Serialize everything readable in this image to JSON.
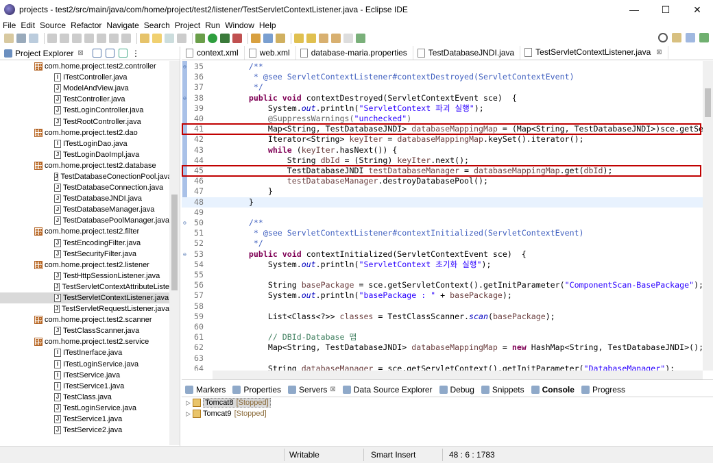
{
  "window": {
    "title": "projects - test2/src/main/java/com/home/project/test2/listener/TestServletContextListener.java - Eclipse IDE",
    "minimize": "—",
    "maximize": "☐",
    "close": "✕"
  },
  "menu": [
    "File",
    "Edit",
    "Source",
    "Refactor",
    "Navigate",
    "Search",
    "Project",
    "Run",
    "Window",
    "Help"
  ],
  "explorer": {
    "title": "Project Explorer",
    "tree": [
      {
        "type": "pkg",
        "label": "com.home.project.test2.controller"
      },
      {
        "type": "file",
        "label": "ITestController.java"
      },
      {
        "type": "file",
        "label": "ModelAndView.java"
      },
      {
        "type": "file",
        "label": "TestController.java"
      },
      {
        "type": "file",
        "label": "TestLoginController.java"
      },
      {
        "type": "file",
        "label": "TestRootController.java"
      },
      {
        "type": "pkg",
        "label": "com.home.project.test2.dao"
      },
      {
        "type": "file",
        "label": "ITestLoginDao.java"
      },
      {
        "type": "file",
        "label": "TestLoginDaoImpl.java"
      },
      {
        "type": "pkg",
        "label": "com.home.project.test2.database"
      },
      {
        "type": "file",
        "label": "TestDatabaseConectionPool.java"
      },
      {
        "type": "file",
        "label": "TestDatabaseConnection.java"
      },
      {
        "type": "file",
        "label": "TestDatabaseJNDI.java"
      },
      {
        "type": "file",
        "label": "TestDatabaseManager.java"
      },
      {
        "type": "file",
        "label": "TestDatabasePoolManager.java"
      },
      {
        "type": "pkg",
        "label": "com.home.project.test2.filter"
      },
      {
        "type": "file",
        "label": "TestEncodingFilter.java"
      },
      {
        "type": "file",
        "label": "TestSecurityFilter.java"
      },
      {
        "type": "pkg",
        "label": "com.home.project.test2.listener"
      },
      {
        "type": "file",
        "label": "TestHttpSessionListener.java"
      },
      {
        "type": "file",
        "label": "TestServletContextAttributeListe"
      },
      {
        "type": "file",
        "label": "TestServletContextListener.java",
        "selected": true
      },
      {
        "type": "file",
        "label": "TestServletRequestListener.java"
      },
      {
        "type": "pkg",
        "label": "com.home.project.test2.scanner"
      },
      {
        "type": "file",
        "label": "TestClassScanner.java"
      },
      {
        "type": "pkg",
        "label": "com.home.project.test2.service"
      },
      {
        "type": "file",
        "label": "ITestInerface.java"
      },
      {
        "type": "file",
        "label": "ITestLoginService.java"
      },
      {
        "type": "file",
        "label": "ITestService.java"
      },
      {
        "type": "file",
        "label": "ITestService1.java"
      },
      {
        "type": "file",
        "label": "TestClass.java"
      },
      {
        "type": "file",
        "label": "TestLoginService.java"
      },
      {
        "type": "file",
        "label": "TestService1.java"
      },
      {
        "type": "file",
        "label": "TestService2.java"
      }
    ]
  },
  "editor_tabs": [
    {
      "label": "context.xml"
    },
    {
      "label": "web.xml"
    },
    {
      "label": "database-maria.properties"
    },
    {
      "label": "TestDatabaseJNDI.java"
    },
    {
      "label": "TestServletContextListener.java",
      "active": true
    }
  ],
  "code": [
    {
      "n": "35",
      "fold": "⊖",
      "parts": [
        [
          "cm",
          "    /**"
        ]
      ]
    },
    {
      "n": "36",
      "parts": [
        [
          "cm",
          "     * @see ServletContextListener#contextDestroyed(ServletContextEvent)"
        ]
      ]
    },
    {
      "n": "37",
      "parts": [
        [
          "cm",
          "     */"
        ]
      ]
    },
    {
      "n": "38",
      "fold": "⊖",
      "parts": [
        [
          "kw",
          "    public void "
        ],
        [
          "",
          "contextDestroyed(ServletContextEvent sce)  {"
        ]
      ]
    },
    {
      "n": "39",
      "parts": [
        [
          "",
          "        System."
        ],
        [
          "fld",
          "out"
        ],
        [
          "",
          ".println("
        ],
        [
          "str",
          "\"ServletContext 파괴 실행\""
        ],
        [
          "",
          ");"
        ]
      ]
    },
    {
      "n": "40",
      "parts": [
        [
          "ann",
          "        @SuppressWarnings("
        ],
        [
          "str",
          "\"unchecked\""
        ],
        [
          "ann",
          ")"
        ]
      ]
    },
    {
      "n": "41",
      "parts": [
        [
          "",
          "        Map<String, TestDatabaseJNDI> "
        ],
        [
          "var",
          "databaseMappingMap"
        ],
        [
          "",
          " = (Map<String, TestDatabaseJNDI>)sce.getServlet("
        ]
      ]
    },
    {
      "n": "42",
      "parts": [
        [
          "",
          "        Iterator<String> "
        ],
        [
          "var",
          "keyIter"
        ],
        [
          "",
          " = "
        ],
        [
          "var",
          "databaseMappingMap"
        ],
        [
          "",
          ".keySet().iterator();"
        ]
      ]
    },
    {
      "n": "43",
      "parts": [
        [
          "kw",
          "        while "
        ],
        [
          "",
          "("
        ],
        [
          "var",
          "keyIter"
        ],
        [
          "",
          ".hasNext()) {"
        ]
      ]
    },
    {
      "n": "44",
      "parts": [
        [
          "",
          "            String "
        ],
        [
          "var",
          "dbId"
        ],
        [
          "",
          " = (String) "
        ],
        [
          "var",
          "keyIter"
        ],
        [
          "",
          ".next();"
        ]
      ]
    },
    {
      "n": "45",
      "parts": [
        [
          "",
          "            TestDatabaseJNDI "
        ],
        [
          "var",
          "testDatabaseManager"
        ],
        [
          "",
          " = "
        ],
        [
          "var",
          "databaseMappingMap"
        ],
        [
          "",
          ".get("
        ],
        [
          "var",
          "dbId"
        ],
        [
          "",
          ");"
        ]
      ]
    },
    {
      "n": "46",
      "parts": [
        [
          "var",
          "            testDatabaseManager"
        ],
        [
          "",
          ".destroyDatabasePool();"
        ]
      ]
    },
    {
      "n": "47",
      "parts": [
        [
          "",
          "        }"
        ]
      ]
    },
    {
      "n": "48",
      "cur": true,
      "parts": [
        [
          "",
          "    }"
        ]
      ]
    },
    {
      "n": "49",
      "parts": [
        [
          "",
          ""
        ]
      ]
    },
    {
      "n": "50",
      "fold": "⊖",
      "parts": [
        [
          "cm",
          "    /**"
        ]
      ]
    },
    {
      "n": "51",
      "parts": [
        [
          "cm",
          "     * @see ServletContextListener#contextInitialized(ServletContextEvent)"
        ]
      ]
    },
    {
      "n": "52",
      "parts": [
        [
          "cm",
          "     */"
        ]
      ]
    },
    {
      "n": "53",
      "fold": "⊖",
      "parts": [
        [
          "kw",
          "    public void "
        ],
        [
          "",
          "contextInitialized(ServletContextEvent sce)  {"
        ]
      ]
    },
    {
      "n": "54",
      "parts": [
        [
          "",
          "        System."
        ],
        [
          "fld",
          "out"
        ],
        [
          "",
          ".println("
        ],
        [
          "str",
          "\"ServletContext 초기화 실행\""
        ],
        [
          "",
          ");"
        ]
      ]
    },
    {
      "n": "55",
      "parts": [
        [
          "",
          ""
        ]
      ]
    },
    {
      "n": "56",
      "parts": [
        [
          "",
          "        String "
        ],
        [
          "var",
          "basePackage"
        ],
        [
          "",
          " = sce.getServletContext().getInitParameter("
        ],
        [
          "str",
          "\"ComponentScan-BasePackage\""
        ],
        [
          "",
          ");"
        ]
      ]
    },
    {
      "n": "57",
      "parts": [
        [
          "",
          "        System."
        ],
        [
          "fld",
          "out"
        ],
        [
          "",
          ".println("
        ],
        [
          "str",
          "\"basePackage : \""
        ],
        [
          "",
          " + "
        ],
        [
          "var",
          "basePackage"
        ],
        [
          "",
          ");"
        ]
      ]
    },
    {
      "n": "58",
      "parts": [
        [
          "",
          ""
        ]
      ]
    },
    {
      "n": "59",
      "parts": [
        [
          "",
          "        List<Class<?>> "
        ],
        [
          "var",
          "classes"
        ],
        [
          "",
          " = TestClassScanner."
        ],
        [
          "fld",
          "scan"
        ],
        [
          "",
          "("
        ],
        [
          "var",
          "basePackage"
        ],
        [
          "",
          ");"
        ]
      ]
    },
    {
      "n": "60",
      "parts": [
        [
          "",
          ""
        ]
      ]
    },
    {
      "n": "61",
      "parts": [
        [
          "lcm",
          "        // DBId-Database 맵"
        ]
      ]
    },
    {
      "n": "62",
      "parts": [
        [
          "",
          "        Map<String, TestDatabaseJNDI> "
        ],
        [
          "var",
          "databaseMappingMap"
        ],
        [
          "",
          " = "
        ],
        [
          "kw",
          "new "
        ],
        [
          "",
          "HashMap<String, TestDatabaseJNDI>();"
        ]
      ]
    },
    {
      "n": "63",
      "parts": [
        [
          "",
          ""
        ]
      ]
    },
    {
      "n": "64",
      "parts": [
        [
          "",
          "        String "
        ],
        [
          "var",
          "databaseManager"
        ],
        [
          "",
          " = sce.getServletContext().getInitParameter("
        ],
        [
          "str",
          "\"DatabaseManager\""
        ],
        [
          "",
          ");"
        ]
      ]
    }
  ],
  "bottom_tabs": [
    {
      "label": "Markers"
    },
    {
      "label": "Properties"
    },
    {
      "label": "Servers",
      "close": "⊠"
    },
    {
      "label": "Data Source Explorer"
    },
    {
      "label": "Debug"
    },
    {
      "label": "Snippets"
    },
    {
      "label": "Console",
      "bold": true
    },
    {
      "label": "Progress"
    }
  ],
  "servers": [
    {
      "name": "Tomcat8",
      "status": "[Stopped]",
      "selected": true
    },
    {
      "name": "Tomcat9",
      "status": "[Stopped]"
    }
  ],
  "status": {
    "writable": "Writable",
    "insert_mode": "Smart Insert",
    "position": "48 : 6 : 1783"
  },
  "colors": {
    "highlight_box": "#c00000",
    "keyword": "#7f0055",
    "string": "#2a00ff",
    "javadoc": "#3f5fbf"
  }
}
